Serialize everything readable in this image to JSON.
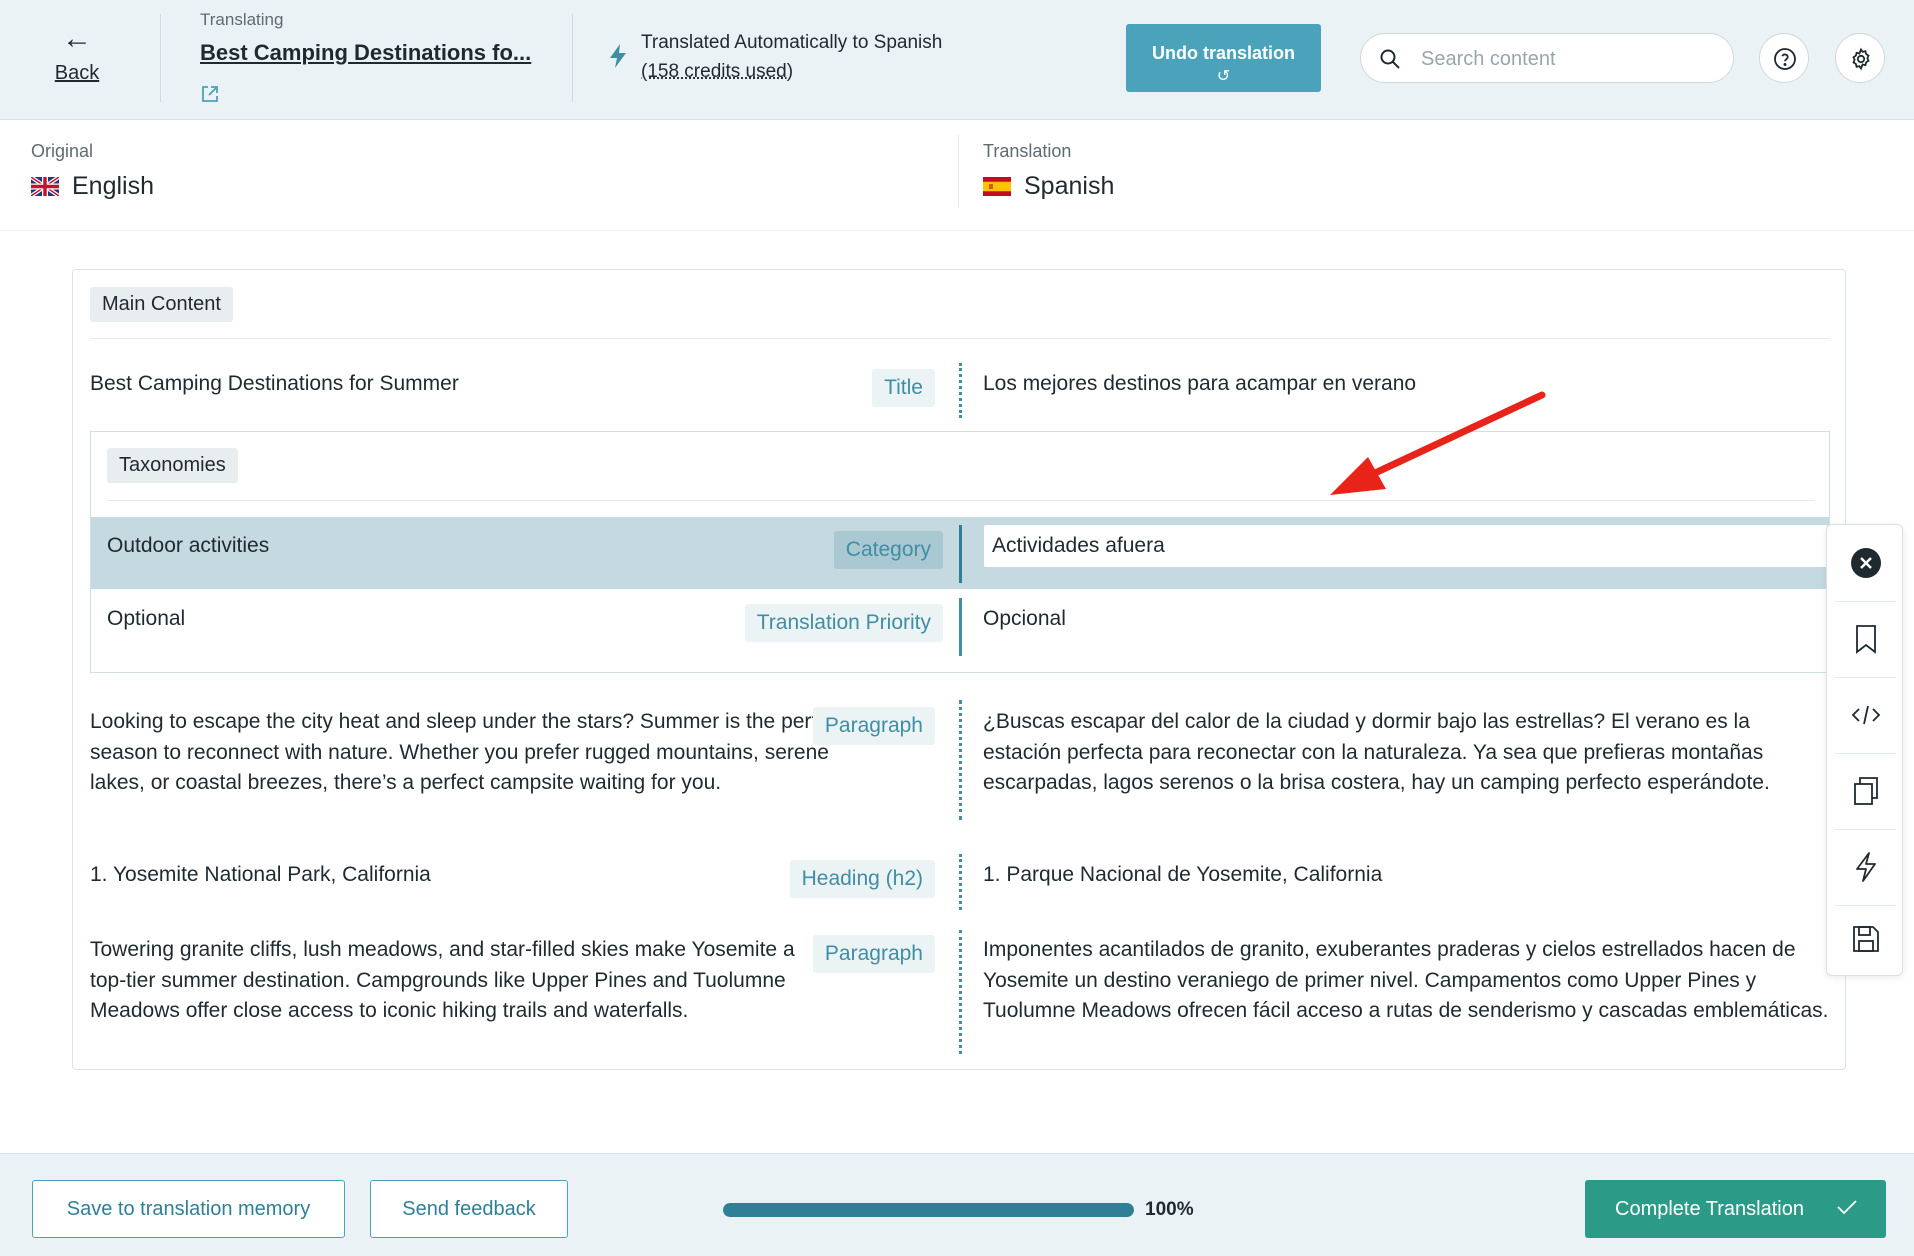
{
  "header": {
    "back_label": "Back",
    "translating_label": "Translating",
    "document_title": "Best Camping Destinations fo...",
    "auto_line1": "Translated Automatically to Spanish",
    "auto_line2": "(158 credits used)",
    "undo_label": "Undo translation",
    "search_placeholder": "Search content"
  },
  "languages": {
    "original_label": "Original",
    "original_name": "English",
    "translation_label": "Translation",
    "translation_name": "Spanish"
  },
  "content": {
    "main_section": "Main Content",
    "taxonomies_section": "Taxonomies",
    "rows": [
      {
        "source": "Best Camping Destinations for Summer",
        "type": "Title",
        "translation": "Los mejores destinos para acampar en verano"
      },
      {
        "source": "Outdoor activities",
        "type": "Category",
        "translation": "Actividades afuera"
      },
      {
        "source": "Optional",
        "type": "Translation Priority",
        "translation": "Opcional"
      },
      {
        "source": "Looking to escape the city heat and sleep under the stars? Summer is the perfect season to reconnect with nature. Whether you prefer rugged mountains, serene lakes, or coastal breezes, there’s a perfect campsite waiting for you.",
        "type": "Paragraph",
        "translation": "¿Buscas escapar del calor de la ciudad y dormir bajo las estrellas? El verano es la estación perfecta para reconectar con la naturaleza. Ya sea que prefieras montañas escarpadas, lagos serenos o la brisa costera, hay un camping perfecto esperándote."
      },
      {
        "source": "1. Yosemite National Park, California",
        "type": "Heading (h2)",
        "translation": "1. Parque Nacional de Yosemite, California"
      },
      {
        "source": "Towering granite cliffs, lush meadows, and star-filled skies make Yosemite a top-tier summer destination. Campgrounds like Upper Pines and Tuolumne Meadows offer close access to iconic hiking trails and waterfalls.",
        "type": "Paragraph",
        "translation": "Imponentes acantilados de granito, exuberantes praderas y cielos estrellados hacen de Yosemite un destino veraniego de primer nivel. Campamentos como Upper Pines y Tuolumne Meadows ofrecen fácil acceso a rutas de senderismo y cascadas emblemáticas."
      }
    ]
  },
  "toolbar": {
    "icons": [
      "close-icon",
      "bookmark-icon",
      "code-icon",
      "copy-icon",
      "lightning-icon",
      "save-icon"
    ]
  },
  "footer": {
    "save_memory_label": "Save to translation memory",
    "send_feedback_label": "Send feedback",
    "progress_percent": 100,
    "progress_text": "100%",
    "complete_label": "Complete Translation"
  },
  "colors": {
    "accent": "#4aa3ba",
    "teal_dark": "#2f7f96",
    "complete_green": "#2b9a86",
    "active_row": "#c4d9e0",
    "annotation_red": "#e8231a"
  }
}
